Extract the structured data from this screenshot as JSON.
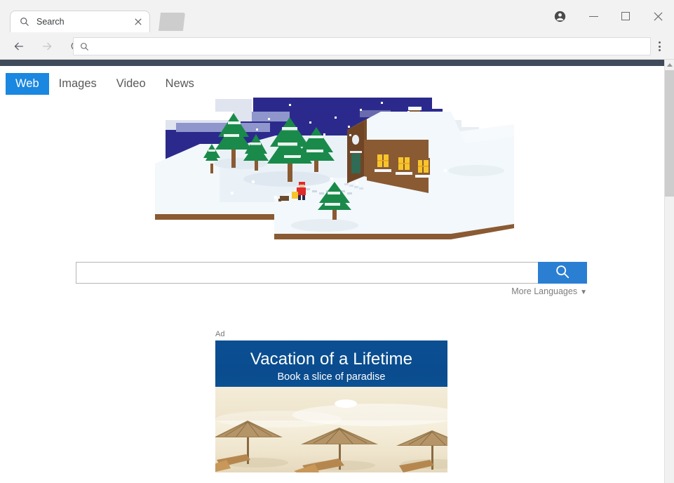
{
  "window": {
    "tab": {
      "title": "Search",
      "favicon_icon": "search-icon",
      "close_icon": "close-icon"
    },
    "controls": {
      "profile_icon": "profile-avatar-icon",
      "minimize_icon": "minimize-icon",
      "maximize_icon": "maximize-icon",
      "close_icon": "window-close-icon"
    },
    "toolbar": {
      "back_icon": "back-arrow-icon",
      "forward_icon": "forward-arrow-icon",
      "reload_icon": "reload-icon",
      "menu_icon": "three-dot-menu-icon",
      "address_value": "",
      "address_placeholder": "",
      "address_leading_icon": "search-icon"
    }
  },
  "page": {
    "topbar_color": "#3f4b5b",
    "nav": {
      "tabs": [
        {
          "label": "Web",
          "active": true
        },
        {
          "label": "Images",
          "active": false
        },
        {
          "label": "Video",
          "active": false
        },
        {
          "label": "News",
          "active": false
        }
      ],
      "active_bg": "#1a87e0",
      "active_fg": "#ffffff",
      "inactive_fg": "#58595b"
    },
    "logo": {
      "name": "winter-village-illustration",
      "alt": "Isometric pixel-art winter scene with snow covered house, pine trees, a person and night sky",
      "sky_color": "#2b2a8c",
      "snow_color": "#f2f7fa",
      "tree_color": "#1a8a4a",
      "house_color": "#8a5a33",
      "window_light": "#ffd24d"
    },
    "search": {
      "value": "",
      "placeholder": "",
      "button_icon": "search-icon",
      "button_color": "#2a7fd2",
      "more_languages_label": "More Languages",
      "more_languages_caret": "▼"
    },
    "ad": {
      "label": "Ad",
      "title": "Vacation of a Lifetime",
      "subtitle": "Book a slice of paradise",
      "header_color": "#0a4c8e",
      "image_alt": "Tropical beach with thatched umbrellas, lounge chairs and turquoise sea"
    },
    "scrollbar": {
      "up_arrow_icon": "scroll-up-arrow-icon",
      "thumb_name": "scrollbar-thumb"
    }
  }
}
